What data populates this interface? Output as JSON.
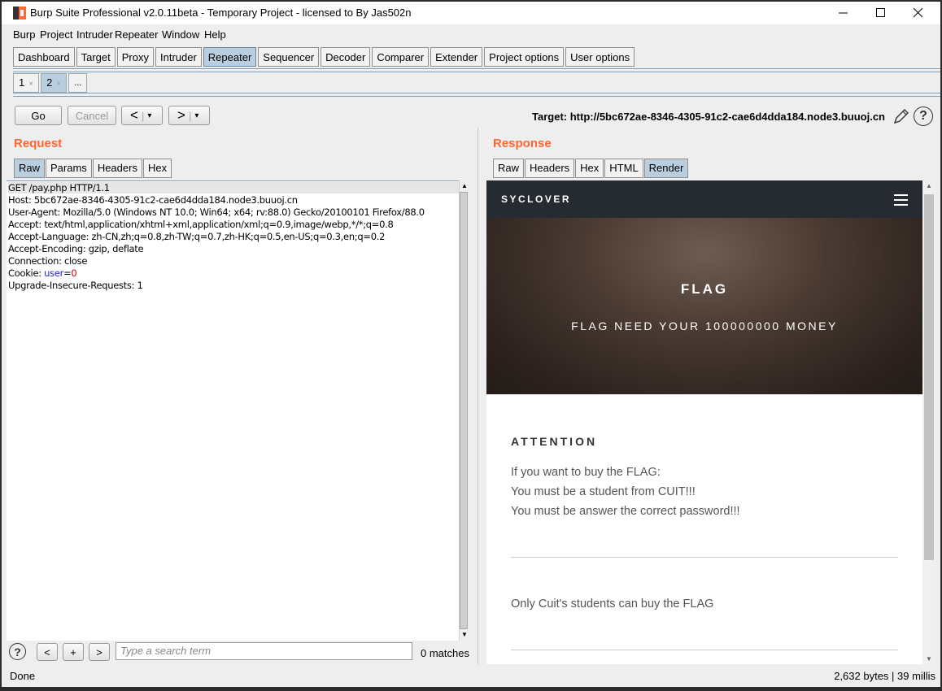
{
  "window": {
    "title": "Burp Suite Professional v2.0.11beta - Temporary Project - licensed to By Jas502n"
  },
  "menu": [
    "Burp",
    "Project",
    "Intruder",
    "Repeater",
    "Window",
    "Help"
  ],
  "main_tabs": [
    "Dashboard",
    "Target",
    "Proxy",
    "Intruder",
    "Repeater",
    "Sequencer",
    "Decoder",
    "Comparer",
    "Extender",
    "Project options",
    "User options"
  ],
  "repeater_tabs": [
    "1",
    "2",
    "..."
  ],
  "toolbar": {
    "go": "Go",
    "cancel": "Cancel",
    "back": "<",
    "forward": ">",
    "dropdown": "▾"
  },
  "target": "Target: http://5bc672ae-8346-4305-91c2-cae6d4dda184.node3.buuoj.cn",
  "request": {
    "title": "Request",
    "tabs": [
      "Raw",
      "Params",
      "Headers",
      "Hex"
    ],
    "lines": [
      "GET /pay.php HTTP/1.1",
      "Host: 5bc672ae-8346-4305-91c2-cae6d4dda184.node3.buuoj.cn",
      "User-Agent: Mozilla/5.0 (Windows NT 10.0; Win64; x64; rv:88.0) Gecko/20100101 Firefox/88.0",
      "Accept: text/html,application/xhtml+xml,application/xml;q=0.9,image/webp,*/*;q=0.8",
      "Accept-Language: zh-CN,zh;q=0.8,zh-TW;q=0.7,zh-HK;q=0.5,en-US;q=0.3,en;q=0.2",
      "Accept-Encoding: gzip, deflate",
      "Connection: close"
    ],
    "cookie_label": "Cookie: ",
    "cookie_key": "user",
    "cookie_eq": "=",
    "cookie_val": "0",
    "last_line": "Upgrade-Insecure-Requests: 1"
  },
  "search": {
    "placeholder": "Type a search term",
    "matches": "0 matches",
    "prev": "<",
    "add": "+",
    "next": ">"
  },
  "response": {
    "title": "Response",
    "tabs": [
      "Raw",
      "Headers",
      "Hex",
      "HTML",
      "Render"
    ],
    "page": {
      "brand": "SYCLOVER",
      "hero_title": "FLAG",
      "hero_sub": "FLAG NEED YOUR 100000000 MONEY",
      "attention": "ATTENTION",
      "lines": [
        "If you want to buy the FLAG:",
        "You must be a student from CUIT!!!",
        "You must be answer the correct password!!!"
      ],
      "note": "Only Cuit's students can buy the FLAG"
    }
  },
  "status": {
    "left": "Done",
    "right": "2,632 bytes | 39 millis"
  },
  "colors": {
    "accent": "#ff6633",
    "tab_selected": "#b9cfe0",
    "cookie_key": "#2222cc",
    "cookie_value": "#cc0000"
  }
}
